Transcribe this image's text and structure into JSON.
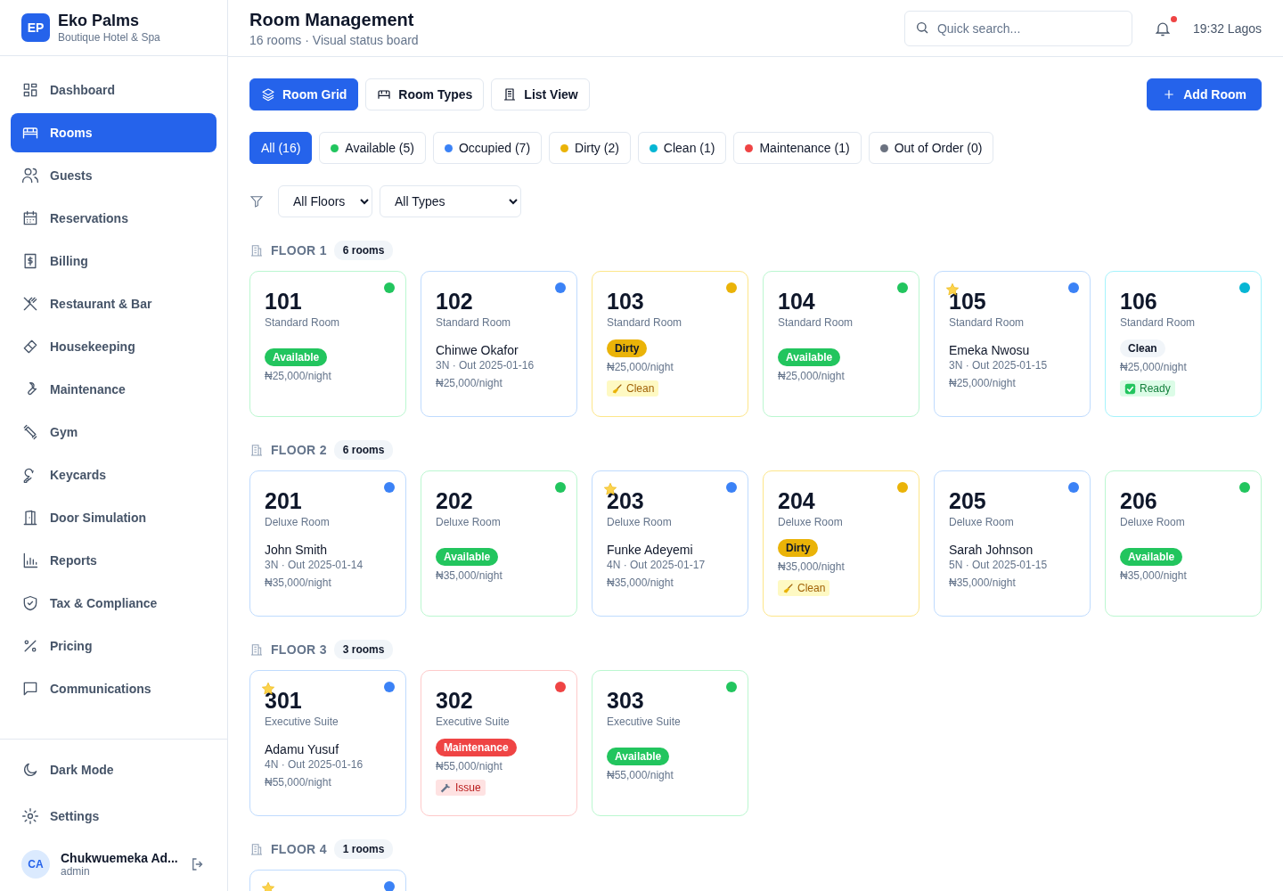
{
  "brand": {
    "logo": "EP",
    "name": "Eko Palms",
    "tagline": "Boutique Hotel & Spa"
  },
  "sidebar": {
    "items": [
      {
        "label": "Dashboard",
        "selected": false
      },
      {
        "label": "Rooms",
        "selected": true
      },
      {
        "label": "Guests",
        "selected": false
      },
      {
        "label": "Reservations",
        "selected": false
      },
      {
        "label": "Billing",
        "selected": false
      },
      {
        "label": "Restaurant & Bar",
        "selected": false
      },
      {
        "label": "Housekeeping",
        "selected": false
      },
      {
        "label": "Maintenance",
        "selected": false
      },
      {
        "label": "Gym",
        "selected": false
      },
      {
        "label": "Keycards",
        "selected": false
      },
      {
        "label": "Door Simulation",
        "selected": false
      },
      {
        "label": "Reports",
        "selected": false
      },
      {
        "label": "Tax & Compliance",
        "selected": false
      },
      {
        "label": "Pricing",
        "selected": false
      },
      {
        "label": "Communications",
        "selected": false
      }
    ],
    "footer_items": [
      {
        "label": "Dark Mode"
      },
      {
        "label": "Settings"
      }
    ],
    "user": {
      "initials": "CA",
      "name": "Chukwuemeka Ad...",
      "role": "admin"
    }
  },
  "header": {
    "title": "Room Management",
    "subtitle": "16 rooms · Visual status board",
    "search": {
      "placeholder": "Quick search..."
    },
    "notification_dot": true,
    "clock": "19:32 Lagos"
  },
  "view_tabs": [
    {
      "label": "Room Grid",
      "selected": true
    },
    {
      "label": "Room Types",
      "selected": false
    },
    {
      "label": "List View",
      "selected": false
    }
  ],
  "add_button": "Add Room",
  "status_filters": [
    {
      "label": "All (16)",
      "selected": true
    },
    {
      "label": "Available (5)",
      "selected": false,
      "color": "#22c55e"
    },
    {
      "label": "Occupied (7)",
      "selected": false,
      "color": "#3b82f6"
    },
    {
      "label": "Dirty (2)",
      "selected": false,
      "color": "#eab308"
    },
    {
      "label": "Clean (1)",
      "selected": false,
      "color": "#06b6d4"
    },
    {
      "label": "Maintenance (1)",
      "selected": false,
      "color": "#ef4444"
    },
    {
      "label": "Out of Order (0)",
      "selected": false,
      "color": "#6b7280"
    }
  ],
  "filters": [
    {
      "value": "All Floors"
    },
    {
      "value": "All Types"
    }
  ],
  "floors": [
    {
      "label": "FLOOR 1",
      "count": "6 rooms",
      "rooms": [
        {
          "number": "101",
          "type": "Standard Room",
          "kind": "available",
          "color": "#22c55e",
          "vip": false,
          "badge": "Available",
          "price": "₦25,000/night"
        },
        {
          "number": "102",
          "type": "Standard Room",
          "kind": "occupied",
          "color": "#3b82f6",
          "vip": false,
          "guest": "Chinwe Okafor",
          "stay": "3N · Out 2025-01-16",
          "price": "₦25,000/night"
        },
        {
          "number": "103",
          "type": "Standard Room",
          "kind": "dirty",
          "color": "#eab308",
          "vip": false,
          "badge": "Dirty",
          "price": "₦25,000/night",
          "tag": {
            "kind": "cleaning",
            "label": "Clean"
          }
        },
        {
          "number": "104",
          "type": "Standard Room",
          "kind": "available",
          "color": "#22c55e",
          "vip": false,
          "badge": "Available",
          "price": "₦25,000/night"
        },
        {
          "number": "105",
          "type": "Standard Room",
          "kind": "occupied",
          "color": "#3b82f6",
          "vip": true,
          "guest": "Emeka Nwosu",
          "stay": "3N · Out 2025-01-15",
          "price": "₦25,000/night"
        },
        {
          "number": "106",
          "type": "Standard Room",
          "kind": "clean",
          "color": "#06b6d4",
          "vip": false,
          "badge": "Clean",
          "price": "₦25,000/night",
          "tag": {
            "kind": "ready",
            "label": "Ready"
          }
        }
      ]
    },
    {
      "label": "FLOOR 2",
      "count": "6 rooms",
      "rooms": [
        {
          "number": "201",
          "type": "Deluxe Room",
          "kind": "occupied",
          "color": "#3b82f6",
          "vip": false,
          "guest": "John Smith",
          "stay": "3N · Out 2025-01-14",
          "price": "₦35,000/night"
        },
        {
          "number": "202",
          "type": "Deluxe Room",
          "kind": "available",
          "color": "#22c55e",
          "vip": false,
          "badge": "Available",
          "price": "₦35,000/night"
        },
        {
          "number": "203",
          "type": "Deluxe Room",
          "kind": "occupied",
          "color": "#3b82f6",
          "vip": true,
          "guest": "Funke Adeyemi",
          "stay": "4N · Out 2025-01-17",
          "price": "₦35,000/night"
        },
        {
          "number": "204",
          "type": "Deluxe Room",
          "kind": "dirty",
          "color": "#eab308",
          "vip": false,
          "badge": "Dirty",
          "price": "₦35,000/night",
          "tag": {
            "kind": "cleaning",
            "label": "Clean"
          }
        },
        {
          "number": "205",
          "type": "Deluxe Room",
          "kind": "occupied",
          "color": "#3b82f6",
          "vip": false,
          "guest": "Sarah Johnson",
          "stay": "5N · Out 2025-01-15",
          "price": "₦35,000/night"
        },
        {
          "number": "206",
          "type": "Deluxe Room",
          "kind": "available",
          "color": "#22c55e",
          "vip": false,
          "badge": "Available",
          "price": "₦35,000/night"
        }
      ]
    },
    {
      "label": "FLOOR 3",
      "count": "3 rooms",
      "rooms": [
        {
          "number": "301",
          "type": "Executive Suite",
          "kind": "occupied",
          "color": "#3b82f6",
          "vip": true,
          "guest": "Adamu Yusuf",
          "stay": "4N · Out 2025-01-16",
          "price": "₦55,000/night"
        },
        {
          "number": "302",
          "type": "Executive Suite",
          "kind": "maintenance",
          "color": "#ef4444",
          "vip": false,
          "badge": "Maintenance",
          "price": "₦55,000/night",
          "tag": {
            "kind": "issue",
            "label": "Issue"
          }
        },
        {
          "number": "303",
          "type": "Executive Suite",
          "kind": "available",
          "color": "#22c55e",
          "vip": false,
          "badge": "Available",
          "price": "₦55,000/night"
        }
      ]
    },
    {
      "label": "FLOOR 4",
      "count": "1 rooms",
      "rooms": [
        {
          "kind": "occupied",
          "color": "#3b82f6",
          "vip": true
        }
      ]
    }
  ]
}
